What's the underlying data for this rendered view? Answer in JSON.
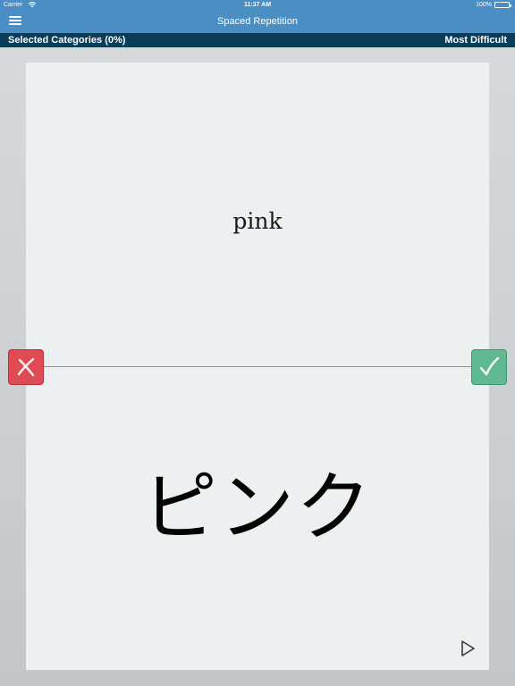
{
  "status_bar": {
    "carrier": "Carrier",
    "time": "11:37 AM",
    "battery": "100%"
  },
  "nav": {
    "title": "Spaced Repetition",
    "menu_icon": "hamburger-menu-icon"
  },
  "subheader": {
    "categories_label": "Selected Categories (0%)",
    "mode_label": "Most Difficult"
  },
  "card": {
    "prompt": "pink",
    "answer": "ピンク"
  },
  "actions": {
    "wrong_icon": "x-mark-icon",
    "correct_icon": "check-mark-icon",
    "play_icon": "play-icon"
  },
  "colors": {
    "nav_blue": "#4a8ec4",
    "subheader_navy": "#0b3c5a",
    "wrong_red": "#e04a52",
    "correct_green": "#5fba93",
    "card_bg": "#edf0f1"
  }
}
